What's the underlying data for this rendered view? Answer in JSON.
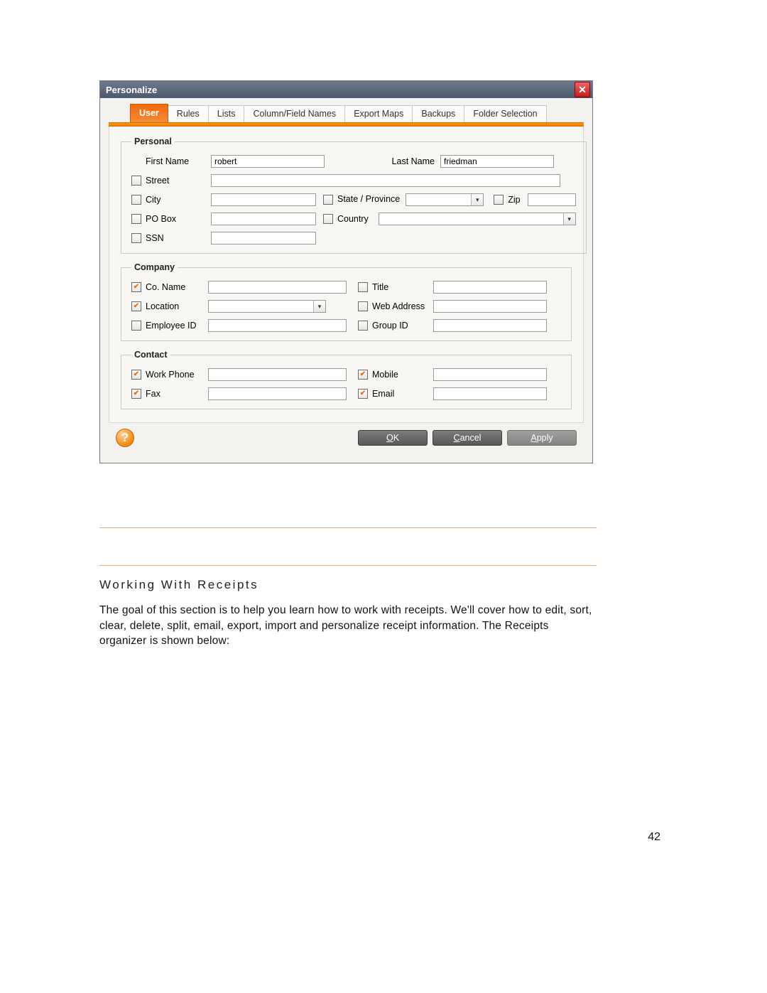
{
  "dialog": {
    "title": "Personalize",
    "tabs": {
      "user": "User",
      "rules": "Rules",
      "lists": "Lists",
      "column_field_names": "Column/Field Names",
      "export_maps": "Export Maps",
      "backups": "Backups",
      "folder_selection": "Folder Selection"
    },
    "groups": {
      "personal": {
        "legend": "Personal",
        "first_name_label": "First Name",
        "first_name_value": "robert",
        "last_name_label": "Last Name",
        "last_name_value": "friedman",
        "street_label": "Street",
        "city_label": "City",
        "state_label": "State / Province",
        "zip_label": "Zip",
        "po_box_label": "PO Box",
        "country_label": "Country",
        "ssn_label": "SSN"
      },
      "company": {
        "legend": "Company",
        "co_name_label": "Co. Name",
        "title_label": "Title",
        "location_label": "Location",
        "web_address_label": "Web Address",
        "employee_id_label": "Employee ID",
        "group_id_label": "Group ID"
      },
      "contact": {
        "legend": "Contact",
        "work_phone_label": "Work Phone",
        "mobile_label": "Mobile",
        "fax_label": "Fax",
        "email_label": "Email"
      }
    },
    "buttons": {
      "ok": "OK",
      "cancel": "Cancel",
      "apply": "Apply"
    }
  },
  "section": {
    "heading": "Working With Receipts",
    "body": "The goal of this section is to help you learn how to work with receipts. We'll cover how to edit, sort, clear, delete, split, email, export, import and personalize receipt information.  The Receipts organizer is shown below:"
  },
  "page_number": "42"
}
